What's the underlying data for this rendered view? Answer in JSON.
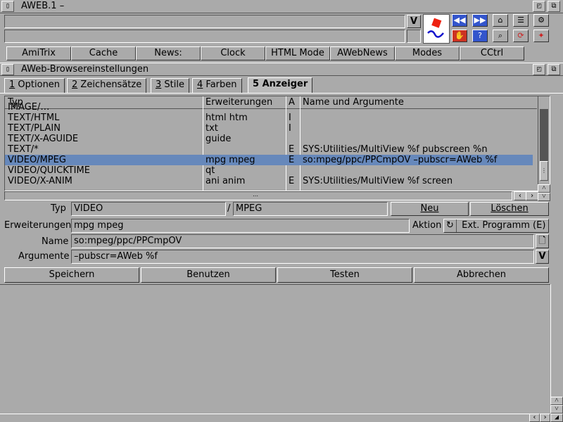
{
  "window": {
    "title": "AWEB.1 –",
    "url_gadget": "V"
  },
  "buttonbar": [
    "AmiTrix",
    "Cache",
    "News:",
    "Clock",
    "HTML Mode",
    "AWebNews",
    "Modes",
    "CCtrl"
  ],
  "prefs": {
    "title": "AWeb-Browsereinstellungen",
    "tabs": [
      {
        "key": "1",
        "label": "Optionen"
      },
      {
        "key": "2",
        "label": "Zeichensätze"
      },
      {
        "key": "3",
        "label": "Stile"
      },
      {
        "key": "4",
        "label": "Farben"
      },
      {
        "key": "5",
        "label": "Anzeiger"
      }
    ],
    "columns": [
      "Typ",
      "Erweiterungen",
      "A",
      "Name und Argumente"
    ],
    "rows": [
      {
        "typ": "IMAGE/…",
        "ext": "",
        "a": "",
        "name": ""
      },
      {
        "typ": "TEXT/HTML",
        "ext": "html htm",
        "a": "I",
        "name": ""
      },
      {
        "typ": "TEXT/PLAIN",
        "ext": "txt",
        "a": "I",
        "name": ""
      },
      {
        "typ": "TEXT/X-AGUIDE",
        "ext": "guide",
        "a": "",
        "name": ""
      },
      {
        "typ": "TEXT/*",
        "ext": "",
        "a": "E",
        "name": "SYS:Utilities/MultiView %f pubscreen %n"
      },
      {
        "typ": "VIDEO/MPEG",
        "ext": "mpg mpeg",
        "a": "E",
        "name": "so:mpeg/ppc/PPCmpOV –pubscr=AWeb %f"
      },
      {
        "typ": "VIDEO/QUICKTIME",
        "ext": "qt",
        "a": "",
        "name": ""
      },
      {
        "typ": "VIDEO/X-ANIM",
        "ext": "ani anim",
        "a": "E",
        "name": "SYS:Utilities/MultiView %f screen"
      }
    ],
    "form": {
      "typ_label": "Typ",
      "typ_major": "VIDEO",
      "typ_sep": "/",
      "typ_minor": "MPEG",
      "new_button": "Neu",
      "delete_button": "Löschen",
      "ext_label": "Erweiterungen",
      "ext_value": "mpg mpeg",
      "action_label": "Aktion",
      "action_value": "Ext. Programm (E)",
      "name_label": "Name",
      "name_value": "so:mpeg/ppc/PPCmpOV",
      "args_label": "Argumente",
      "args_value": "–pubscr=AWeb %f",
      "args_gadget": "V"
    },
    "actions": {
      "save": "Speichern",
      "use": "Benutzen",
      "test": "Testen",
      "cancel": "Abbrechen"
    }
  }
}
